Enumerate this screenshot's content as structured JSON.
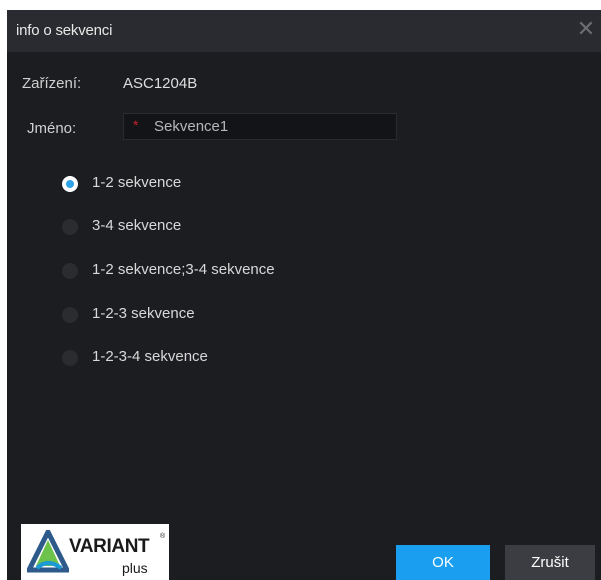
{
  "dialog": {
    "title": "info o sekvenci",
    "close_glyph": "✕"
  },
  "fields": {
    "device_label": "Zařízení:",
    "device_value": "ASC1204B",
    "name_label": "Jméno:",
    "name_required": "*",
    "name_value": "Sekvence1"
  },
  "options": [
    {
      "label": "1-2 sekvence",
      "checked": true
    },
    {
      "label": "3-4 sekvence",
      "checked": false
    },
    {
      "label": "1-2 sekvence;3-4 sekvence",
      "checked": false
    },
    {
      "label": "1-2-3 sekvence",
      "checked": false
    },
    {
      "label": "1-2-3-4 sekvence",
      "checked": false
    }
  ],
  "logo": {
    "brand": "VARIANT",
    "sub": "plus",
    "reg": "®"
  },
  "buttons": {
    "ok": "OK",
    "cancel": "Zrušit"
  },
  "colors": {
    "accent": "#1a9ef0",
    "required": "#c8232a",
    "background": "#1c1d21"
  },
  "icons": {
    "close": "close-icon",
    "required": "required-asterisk",
    "radio": "radio-button"
  }
}
